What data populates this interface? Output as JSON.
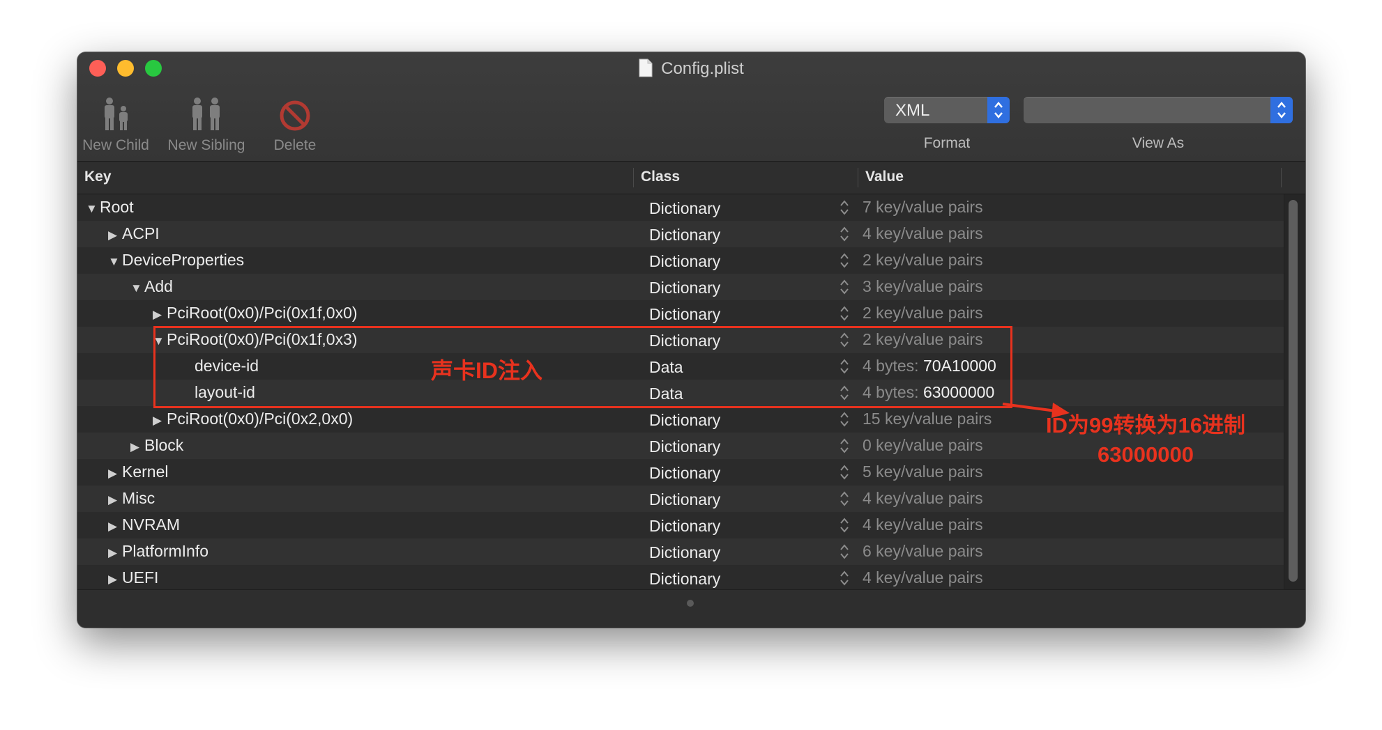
{
  "window": {
    "title": "Config.plist"
  },
  "toolbar": {
    "new_child": "New Child",
    "new_sibling": "New Sibling",
    "delete": "Delete",
    "format_value": "XML",
    "format_caption": "Format",
    "view_as_value": "",
    "view_as_caption": "View As"
  },
  "columns": {
    "key": "Key",
    "class": "Class",
    "value": "Value"
  },
  "rows": [
    {
      "key": "Root",
      "class": "Dictionary",
      "value": "7 key/value pairs",
      "disclosure": "expanded",
      "level": 0
    },
    {
      "key": "ACPI",
      "class": "Dictionary",
      "value": "4 key/value pairs",
      "disclosure": "collapsed",
      "level": 1
    },
    {
      "key": "DeviceProperties",
      "class": "Dictionary",
      "value": "2 key/value pairs",
      "disclosure": "expanded",
      "level": 1
    },
    {
      "key": "Add",
      "class": "Dictionary",
      "value": "3 key/value pairs",
      "disclosure": "expanded",
      "level": 2
    },
    {
      "key": "PciRoot(0x0)/Pci(0x1f,0x0)",
      "class": "Dictionary",
      "value": "2 key/value pairs",
      "disclosure": "collapsed",
      "level": 3
    },
    {
      "key": "PciRoot(0x0)/Pci(0x1f,0x3)",
      "class": "Dictionary",
      "value": "2 key/value pairs",
      "disclosure": "expanded",
      "level": 3
    },
    {
      "key": "device-id",
      "class": "Data",
      "value_prefix": "4 bytes:",
      "value_strong": "70A10000",
      "disclosure": "none",
      "level": 4
    },
    {
      "key": "layout-id",
      "class": "Data",
      "value_prefix": "4 bytes:",
      "value_strong": "63000000",
      "disclosure": "none",
      "level": 4
    },
    {
      "key": "PciRoot(0x0)/Pci(0x2,0x0)",
      "class": "Dictionary",
      "value": "15 key/value pairs",
      "disclosure": "collapsed",
      "level": 3
    },
    {
      "key": "Block",
      "class": "Dictionary",
      "value": "0 key/value pairs",
      "disclosure": "collapsed",
      "level": 2
    },
    {
      "key": "Kernel",
      "class": "Dictionary",
      "value": "5 key/value pairs",
      "disclosure": "collapsed",
      "level": 1
    },
    {
      "key": "Misc",
      "class": "Dictionary",
      "value": "4 key/value pairs",
      "disclosure": "collapsed",
      "level": 1
    },
    {
      "key": "NVRAM",
      "class": "Dictionary",
      "value": "4 key/value pairs",
      "disclosure": "collapsed",
      "level": 1
    },
    {
      "key": "PlatformInfo",
      "class": "Dictionary",
      "value": "6 key/value pairs",
      "disclosure": "collapsed",
      "level": 1
    },
    {
      "key": "UEFI",
      "class": "Dictionary",
      "value": "4 key/value pairs",
      "disclosure": "collapsed",
      "level": 1
    }
  ],
  "annotations": {
    "label_1": "声卡ID注入",
    "label_2_line1": "ID为99转换为16进制",
    "label_2_line2": "63000000",
    "color": "#e8321e"
  },
  "colors": {
    "window_bg": "#2b2b2b",
    "accent_blue": "#2f6fe0",
    "text": "#ececec",
    "muted_value": "#8b8b8b"
  },
  "icons": {
    "disclosure_expanded": "▼",
    "disclosure_collapsed": "▶"
  }
}
